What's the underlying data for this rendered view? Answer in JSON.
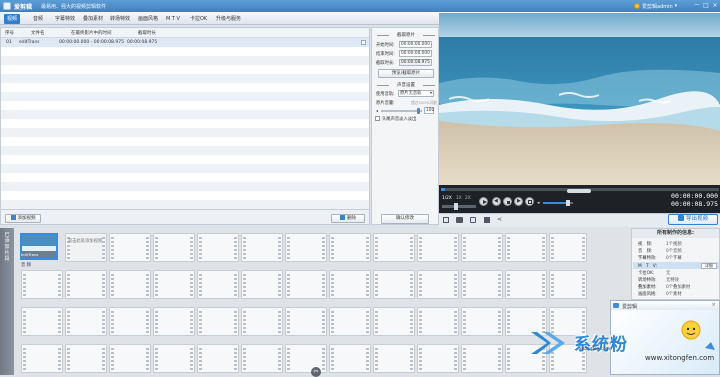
{
  "titlebar": {
    "app_name": "爱剪辑",
    "slogan": "最易用、强大的视频剪辑软件",
    "user": "爱剪辑admin",
    "controls": [
      "－",
      "□",
      "×"
    ]
  },
  "tabs": [
    {
      "label": "视频",
      "active": true
    },
    {
      "label": "音频",
      "active": false
    },
    {
      "label": "字幕特效",
      "active": false
    },
    {
      "label": "叠加素材",
      "active": false
    },
    {
      "label": "转场特效",
      "active": false
    },
    {
      "label": "画面风格",
      "active": false
    },
    {
      "label": "M T V",
      "active": false
    },
    {
      "label": "卡拉OK",
      "active": false
    },
    {
      "label": "升级与服务",
      "active": false
    }
  ],
  "table": {
    "headers": [
      "序号",
      "文件名",
      "在最终影片中的时间",
      "截取时长"
    ],
    "rows": [
      {
        "index": "01",
        "filename": "editTrans",
        "range": "00:00:00.000 - 00:00:08.975",
        "duration": "00:00:08.975"
      }
    ]
  },
  "bottom_buttons": {
    "add": "添加视频",
    "delete": "删除",
    "confirm": "确认修改"
  },
  "settings": {
    "section_clip": "截取原片",
    "start_label": "开始时间:",
    "start_value": "00:00:00.000",
    "end_label": "结束时间:",
    "end_value": "00:00:00.000",
    "dur_label": "截取时长:",
    "dur_value": "00:00:08.975",
    "preview_button": "预览/截取原片",
    "section_audio": "声音设置",
    "track_label": "使用音轨:",
    "track_value": "原片无音轨",
    "vol_label": "原片音量:",
    "vol_hint": "超过100%可能",
    "vol_value": "100",
    "fade_label": "头尾声音淡入淡出"
  },
  "player": {
    "speeds": [
      "1/2X",
      "1X",
      "2X"
    ],
    "current_time": "00:00:00.000",
    "total_time": "00:00:08.975",
    "export_label": "导出视频"
  },
  "storyboard": {
    "side_label": "已添加片段",
    "clip_label": "editTrans",
    "add_hint": "双击此处添加视频",
    "row_label": "音 频"
  },
  "info": {
    "title": "所有制作的信息:",
    "rows": [
      {
        "label": "视　频:",
        "value": "1个视频"
      },
      {
        "label": "音　频:",
        "value": "0个音频"
      },
      {
        "label": "字幕特效:",
        "value": "0个字幕"
      },
      {
        "label": "M　T　V:",
        "value": ""
      },
      {
        "label": "卡拉OK:",
        "value": "无"
      },
      {
        "label": "转场特效:",
        "value": "无特效"
      },
      {
        "label": "叠加素材:",
        "value": "0个叠加素材"
      },
      {
        "label": "画面风格:",
        "value": "0个素材"
      }
    ],
    "detail_button": "详细"
  },
  "popup": {
    "title": "爱剪辑",
    "close": "×"
  },
  "watermark": {
    "main": "系统粉",
    "sub": "xitongfen.com",
    "logo_text": "系统粉",
    "domain": "www.xitongfen.com"
  },
  "colors": {
    "accent": "#2f7fd0",
    "titlebar": "#4a8bca",
    "export": "#1f6fc1"
  }
}
